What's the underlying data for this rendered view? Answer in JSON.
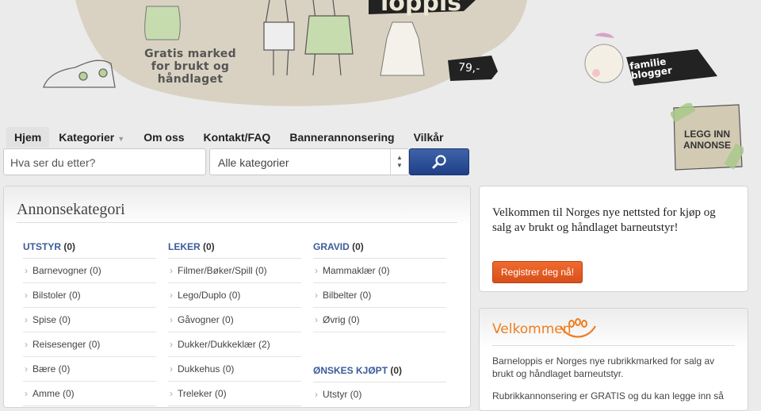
{
  "header": {
    "tagline_line1": "Gratis marked",
    "tagline_line2": "for brukt og håndlaget",
    "logo_word": "loppis",
    "price_tag": "79,-",
    "badge_line1": "familie",
    "badge_line2": "blogger",
    "post_ad_line1": "LEGG INN",
    "post_ad_line2": "ANNONSE"
  },
  "nav": {
    "items": [
      {
        "label": "Hjem",
        "active": true
      },
      {
        "label": "Kategorier",
        "has_dropdown": true
      },
      {
        "label": "Om oss"
      },
      {
        "label": "Kontakt/FAQ"
      },
      {
        "label": "Bannerannonsering"
      },
      {
        "label": "Vilkår"
      }
    ]
  },
  "search": {
    "placeholder": "Hva ser du etter?",
    "category_selected": "Alle kategorier",
    "button_icon": "search-icon"
  },
  "categories": {
    "title": "Annonsekategori",
    "columns": [
      {
        "groups": [
          {
            "name": "UTSTYR",
            "count": "(0)",
            "items": [
              "Barnevogner (0)",
              "Bilstoler (0)",
              "Spise (0)",
              "Reisesenger (0)",
              "Bære (0)",
              "Amme (0)"
            ]
          }
        ]
      },
      {
        "groups": [
          {
            "name": "LEKER",
            "count": "(0)",
            "items": [
              "Filmer/Bøker/Spill (0)",
              "Lego/Duplo (0)",
              "Gåvogner (0)",
              "Dukker/Dukkeklær (2)",
              "Dukkehus (0)",
              "Treleker (0)"
            ]
          }
        ]
      },
      {
        "groups": [
          {
            "name": "GRAVID",
            "count": "(0)",
            "items": [
              "Mammaklær (0)",
              "Bilbelter (0)",
              "Øvrig (0)"
            ]
          },
          {
            "name": "ØNSKES KJØPT",
            "count": "(0)",
            "items": [
              "Utstyr (0)"
            ]
          }
        ]
      }
    ]
  },
  "welcome_box": {
    "text": "Velkommen til Norges nye nettsted for kjøp og salg av brukt og håndlaget barneutstyr!",
    "button": "Registrer deg nå!"
  },
  "about_box": {
    "title": "Velkommen",
    "p1": "Barneloppis er Norges nye rubrikkmarked for salg av brukt og håndlaget barneutstyr.",
    "p2": "Rubrikkannonsering er GRATIS og du kan legge inn så"
  },
  "colors": {
    "nav_link": "#3a5b9a",
    "search_button": "#1f3f86",
    "register_button": "#e55a22",
    "welcome_title": "#ef7d1e",
    "banner_bg": "#d9d2c2"
  }
}
